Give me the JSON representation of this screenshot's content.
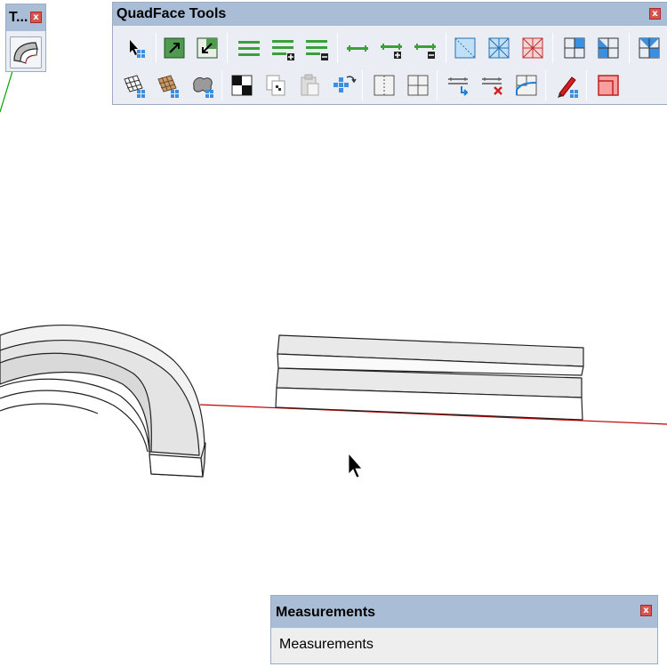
{
  "tool_panel": {
    "title": "T...",
    "close_glyph": "x",
    "tool_icon": "follow-me-icon"
  },
  "quadface": {
    "title": "QuadFace Tools",
    "close_glyph": "x",
    "row1_icons": [
      "select-quad-icon",
      "grow-selection-icon",
      "shrink-selection-icon",
      "select-ring-icon",
      "grow-ring-icon",
      "shrink-ring-icon",
      "select-loop-icon",
      "grow-loop-icon",
      "shrink-loop-icon",
      "region-to-loop-icon",
      "select-bounding-loop-icon",
      "deselect-loop-icon",
      "triangulate-icon",
      "remove-triangulation-icon",
      "make-planar-icon"
    ],
    "row2_icons": [
      "uv-map-icon",
      "uv-mapping-icon",
      "smooth-quad-mesh-icon",
      "checker-icon",
      "copy-uv-icon",
      "paste-uv-icon",
      "unwrap-uv-icon",
      "insert-loops-icon",
      "connect-edges-icon",
      "build-ends-icon",
      "remove-loops-icon",
      "build-corners-icon",
      "line-tool-icon",
      "flip-edge-icon"
    ]
  },
  "measurements": {
    "title": "Measurements",
    "close_glyph": "x",
    "value": "Measurements"
  },
  "colors": {
    "panel_title_bg": "#a9bdd6",
    "panel_bg": "#eaeef4",
    "close_red": "#d9534f",
    "axis_red": "#c00000",
    "axis_green": "#00a000",
    "model_face": "#e6e6e6"
  }
}
